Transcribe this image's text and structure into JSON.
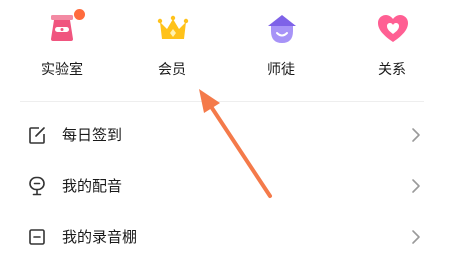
{
  "features": [
    {
      "label": "实验室",
      "icon": "lab-icon",
      "color": "#f0557f"
    },
    {
      "label": "会员",
      "icon": "crown-icon",
      "color": "#ffc21a"
    },
    {
      "label": "师徒",
      "icon": "mentor-icon",
      "color": "#9d82f5"
    },
    {
      "label": "关系",
      "icon": "heart-icon",
      "color": "#ff5f93"
    }
  ],
  "menu": [
    {
      "label": "每日签到",
      "icon": "checkin-edit-icon"
    },
    {
      "label": "我的配音",
      "icon": "microphone-icon"
    },
    {
      "label": "我的录音棚",
      "icon": "studio-icon"
    }
  ],
  "annotation": {
    "icon": "pointer-arrow-icon",
    "color": "#f47a4a"
  },
  "badge_color": "#ff6b3d"
}
